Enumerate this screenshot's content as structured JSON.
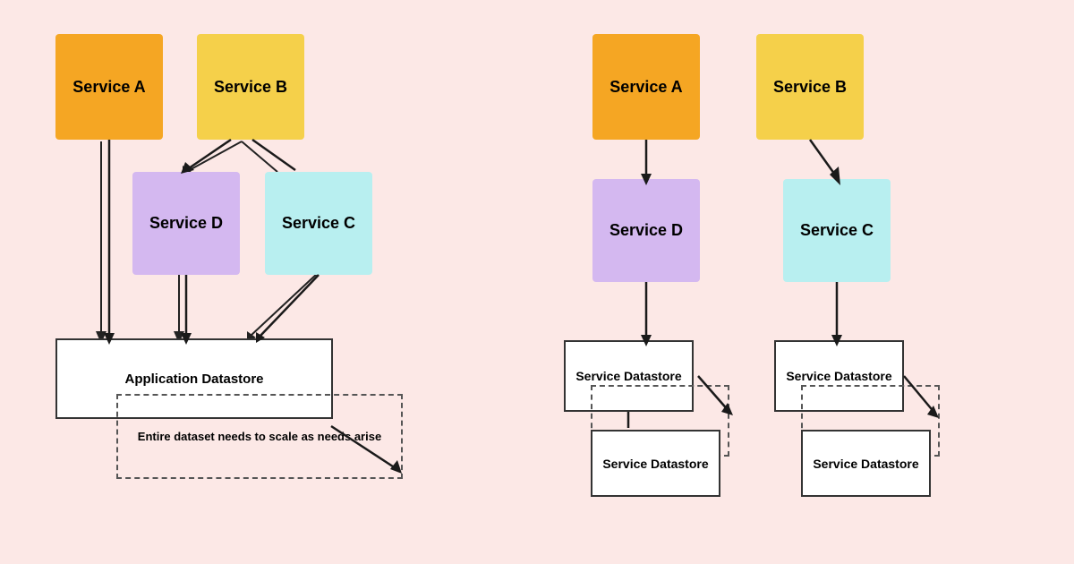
{
  "left": {
    "serviceA": {
      "label": "Service A",
      "color": "orange"
    },
    "serviceB": {
      "label": "Service B",
      "color": "yellow"
    },
    "serviceD": {
      "label": "Service D",
      "color": "lavender"
    },
    "serviceC": {
      "label": "Service C",
      "color": "cyan"
    },
    "datastore": {
      "label": "Application Datastore"
    },
    "dashed_note": {
      "label": "Entire dataset needs to scale as needs arise"
    }
  },
  "right": {
    "serviceA": {
      "label": "Service A",
      "color": "orange"
    },
    "serviceB": {
      "label": "Service B",
      "color": "yellow"
    },
    "serviceD": {
      "label": "Service D",
      "color": "lavender"
    },
    "serviceC": {
      "label": "Service C",
      "color": "cyan"
    },
    "datastoreD1": {
      "label": "Service Datastore"
    },
    "datastoreD2": {
      "label": "Service Datastore"
    },
    "datastoreC1": {
      "label": "Service Datastore"
    },
    "datastoreC2": {
      "label": "Service Datastore"
    }
  }
}
